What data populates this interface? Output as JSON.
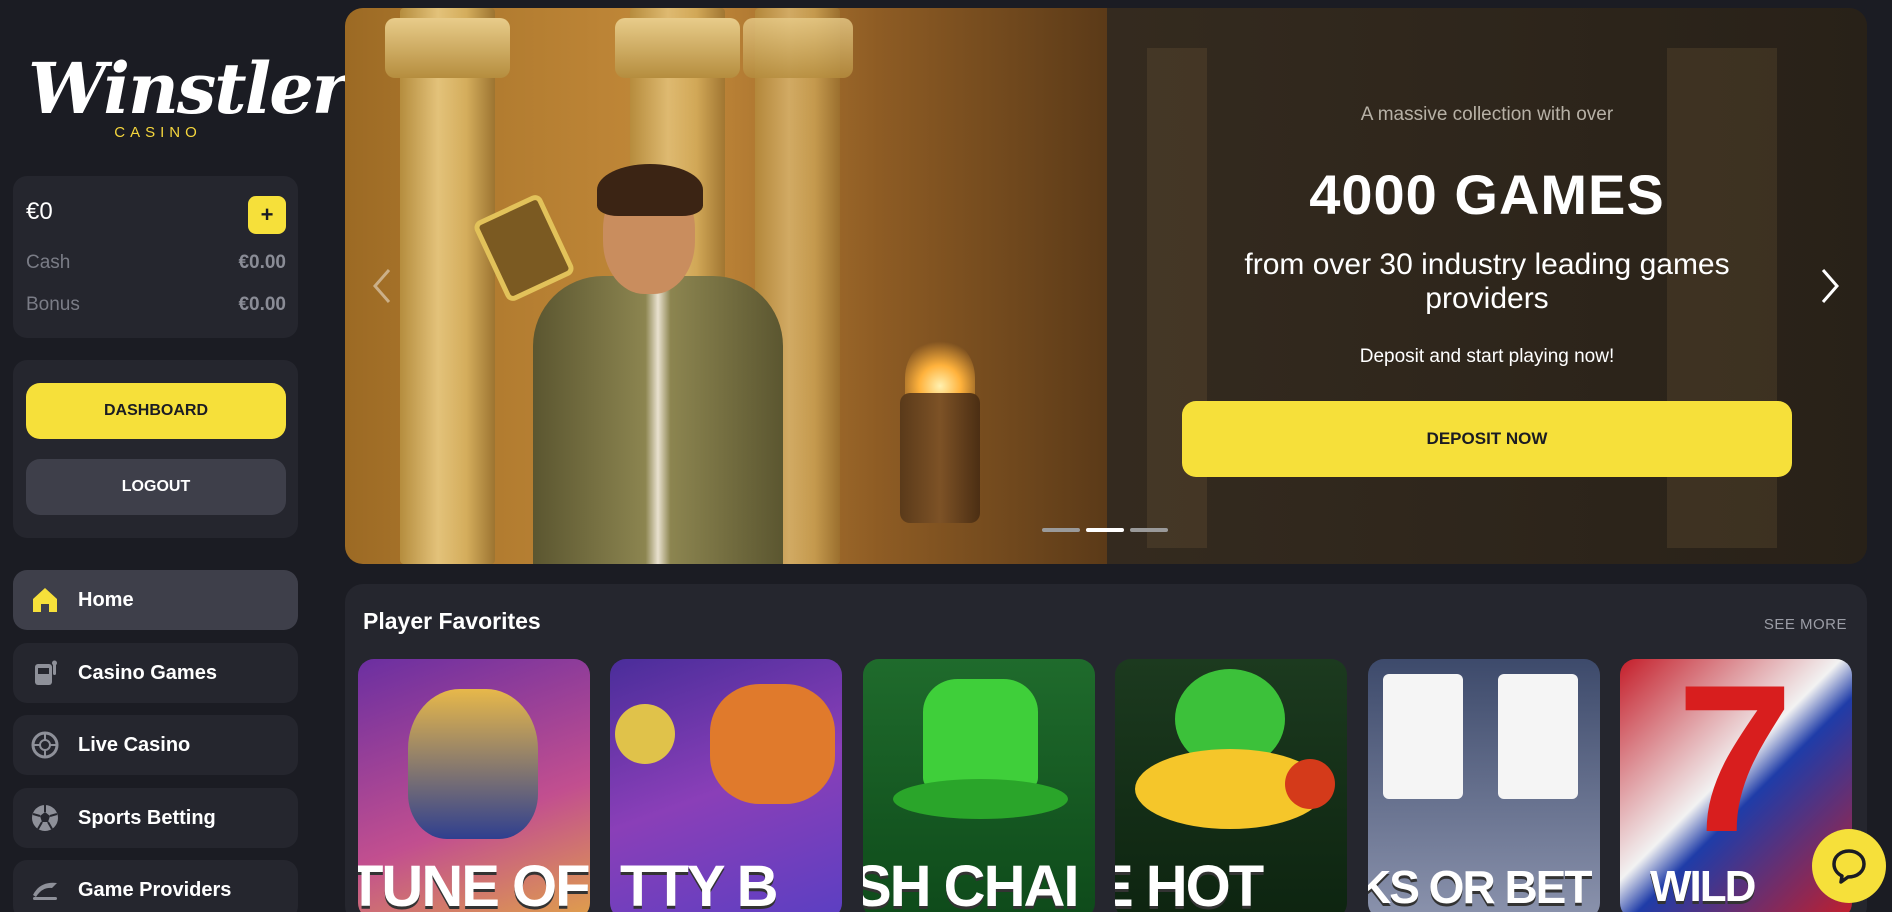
{
  "brand": {
    "name": "Winstler",
    "tagline": "CASINO",
    "accent": "#f6e03a"
  },
  "wallet": {
    "balance": "€0",
    "add_label": "+",
    "cash_label": "Cash",
    "cash_value": "€0.00",
    "bonus_label": "Bonus",
    "bonus_value": "€0.00"
  },
  "actions": {
    "dashboard": "DASHBOARD",
    "logout": "LOGOUT"
  },
  "nav": [
    {
      "label": "Home",
      "icon": "home-icon",
      "active": true
    },
    {
      "label": "Casino Games",
      "icon": "slot-machine-icon",
      "active": false
    },
    {
      "label": "Live Casino",
      "icon": "roulette-icon",
      "active": false
    },
    {
      "label": "Sports Betting",
      "icon": "soccer-ball-icon",
      "active": false
    },
    {
      "label": "Game Providers",
      "icon": "providers-icon",
      "active": false
    }
  ],
  "hero": {
    "eyebrow": "A massive collection with over",
    "title": "4000 GAMES",
    "subtitle": "from over 30 industry leading games providers",
    "cta_text": "Deposit and start playing now!",
    "cta_button": "DEPOSIT NOW",
    "slides": 3,
    "active_slide": 2
  },
  "favorites": {
    "title": "Player Favorites",
    "see_more": "SEE MORE",
    "games": [
      {
        "visible_text": "TUNE OF ("
      },
      {
        "visible_text": "TTY B"
      },
      {
        "visible_text": "SH CHAI"
      },
      {
        "visible_text": "E HOT"
      },
      {
        "visible_text": "KS OR BET"
      },
      {
        "visible_text": "WILD"
      }
    ]
  }
}
